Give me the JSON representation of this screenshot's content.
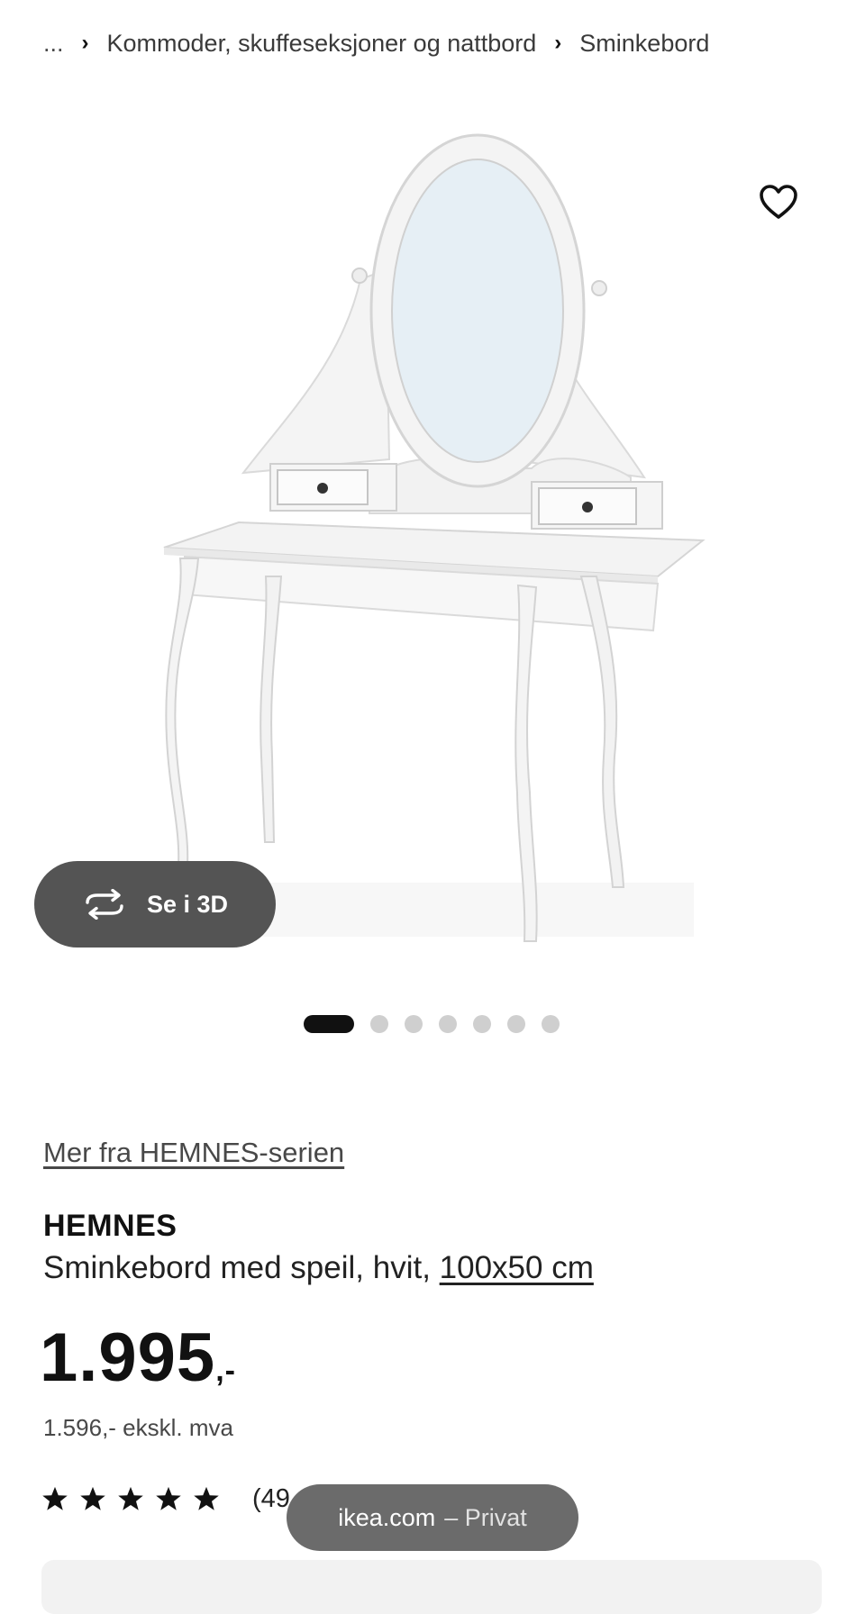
{
  "breadcrumb": {
    "ellipsis": "...",
    "items": [
      "Kommoder, skuffeseksjoner og nattbord",
      "Sminkebord"
    ]
  },
  "gallery": {
    "button_3d_label": "Se i 3D",
    "dot_count": 7,
    "active_dot": 0
  },
  "product": {
    "series_link": "Mer fra HEMNES-serien",
    "name": "HEMNES",
    "description": "Sminkebord med speil, hvit,",
    "size_link": "100x50 cm",
    "price_main": "1.995",
    "price_suffix": ",-",
    "price_ex_vat": "1.596,- ekskl. mva",
    "rating_value": 5,
    "rating_max": 5,
    "rating_count": "(49"
  },
  "browser": {
    "domain": "ikea.com",
    "mode": "– Privat"
  },
  "colors": {
    "text": "#111111",
    "muted": "#484848",
    "button_bg": "#545454",
    "pill_bg": "#6b6b6b"
  }
}
